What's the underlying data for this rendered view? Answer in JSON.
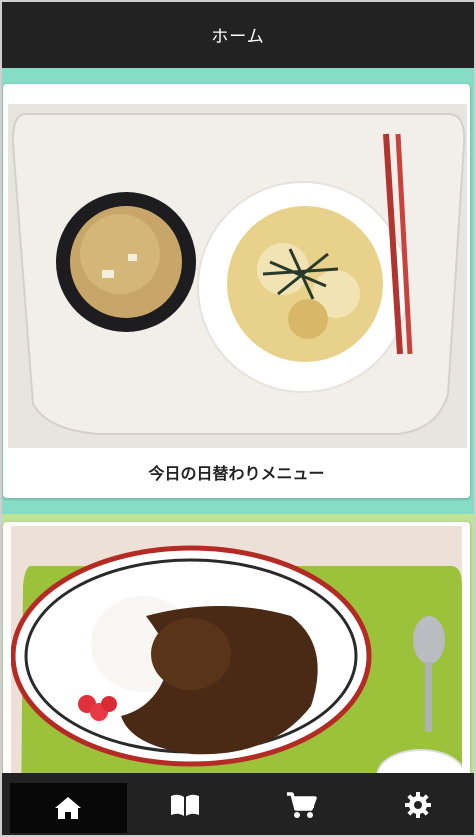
{
  "header": {
    "title": "ホーム"
  },
  "cards": [
    {
      "caption": "今日の日替わりメニュー",
      "photo": "oyakodon-with-miso-soup"
    },
    {
      "caption": "",
      "photo": "curry-rice-plate"
    }
  ],
  "bottom_nav": {
    "items": [
      {
        "icon": "home-icon",
        "active": true
      },
      {
        "icon": "book-icon",
        "active": false
      },
      {
        "icon": "cart-icon",
        "active": false
      },
      {
        "icon": "gear-icon",
        "active": false
      }
    ]
  },
  "colors": {
    "bar": "#222222",
    "section1_bg": "#86ddc6",
    "section2_bg": "#bfe398"
  }
}
